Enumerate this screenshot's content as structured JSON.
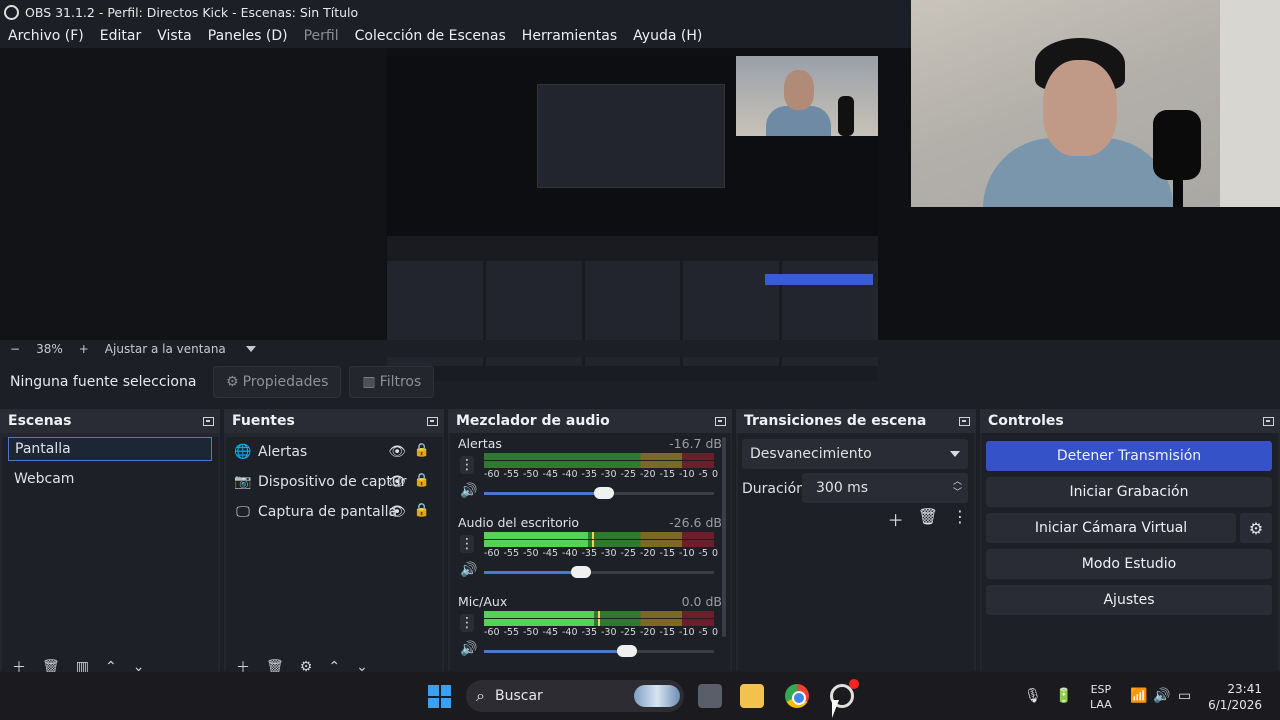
{
  "window": {
    "title": "OBS 31.1.2 - Perfil: Directos Kick - Escenas: Sin Título"
  },
  "menu": [
    {
      "label": "Archivo (F)",
      "enabled": true
    },
    {
      "label": "Editar",
      "enabled": true
    },
    {
      "label": "Vista",
      "enabled": true
    },
    {
      "label": "Paneles (D)",
      "enabled": true
    },
    {
      "label": "Perfil",
      "enabled": false
    },
    {
      "label": "Colección de Escenas",
      "enabled": true
    },
    {
      "label": "Herramientas",
      "enabled": true
    },
    {
      "label": "Ayuda (H)",
      "enabled": true
    }
  ],
  "zoom": {
    "minus": "−",
    "value": "38%",
    "plus": "+",
    "fit_label": "Ajustar a la ventana"
  },
  "source_bar": {
    "label": "Ninguna fuente selecciona",
    "properties": "Propiedades",
    "filters": "Filtros"
  },
  "scenes": {
    "title": "Escenas",
    "items": [
      {
        "label": "Pantalla",
        "selected": true
      },
      {
        "label": "Webcam",
        "selected": false
      }
    ]
  },
  "sources": {
    "title": "Fuentes",
    "items": [
      {
        "label": "Alertas",
        "icon": "globe-icon"
      },
      {
        "label": "Dispositivo de captur",
        "icon": "camera-icon"
      },
      {
        "label": "Captura de pantalla",
        "icon": "monitor-icon"
      }
    ]
  },
  "mixer": {
    "title": "Mezclador de audio",
    "ticks": [
      "-60",
      "-55",
      "-50",
      "-45",
      "-40",
      "-35",
      "-30",
      "-25",
      "-20",
      "-15",
      "-10",
      "-5",
      "0"
    ],
    "channels": [
      {
        "name": "Alertas",
        "db": "-16.7 dB",
        "level": 0.0,
        "volume": 0.52
      },
      {
        "name": "Audio del escritorio",
        "db": "-26.6 dB",
        "level": 0.45,
        "volume": 0.42
      },
      {
        "name": "Mic/Aux",
        "db": "0.0 dB",
        "level": 0.48,
        "volume": 0.62
      }
    ]
  },
  "transitions": {
    "title": "Transiciones de escena",
    "selected": "Desvanecimiento",
    "duration_label": "Duración",
    "duration_value": "300 ms"
  },
  "controls": {
    "title": "Controles",
    "stop_stream": "Detener Transmisión",
    "start_record": "Iniciar Grabación",
    "start_virtual_cam": "Iniciar Cámara Virtual",
    "studio_mode": "Modo Estudio",
    "settings": "Ajustes"
  },
  "taskbar": {
    "search_placeholder": "Buscar",
    "lang_top": "ESP",
    "lang_bottom": "LAA",
    "time": "23:41",
    "date": "6/1/2026"
  },
  "colors": {
    "accent": "#3552c9",
    "meter_green": "#56d356",
    "bg": "#1d1f26"
  }
}
